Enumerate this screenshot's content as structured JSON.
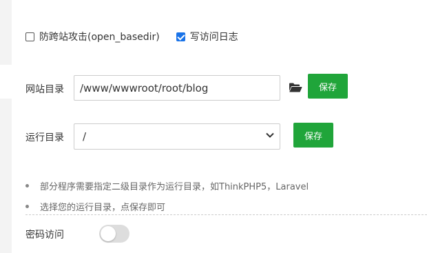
{
  "options": {
    "anti_cross_site_label": "防跨站攻击(open_basedir)",
    "anti_cross_site_checked": false,
    "write_access_log_label": "写访问日志",
    "write_access_log_checked": true
  },
  "site_directory": {
    "label": "网站目录",
    "value": "/www/wwwroot/root/blog",
    "folder_icon": "folder-open-icon",
    "save_label": "保存"
  },
  "run_directory": {
    "label": "运行目录",
    "selected": "/",
    "save_label": "保存"
  },
  "notes": [
    "部分程序需要指定二级目录作为运行目录，如ThinkPHP5，Laravel",
    "选择您的运行目录，点保存即可"
  ],
  "password_access": {
    "label": "密码访问",
    "enabled": false
  },
  "colors": {
    "accent_green": "#20a53a",
    "checkbox_blue": "#1a73e8"
  }
}
